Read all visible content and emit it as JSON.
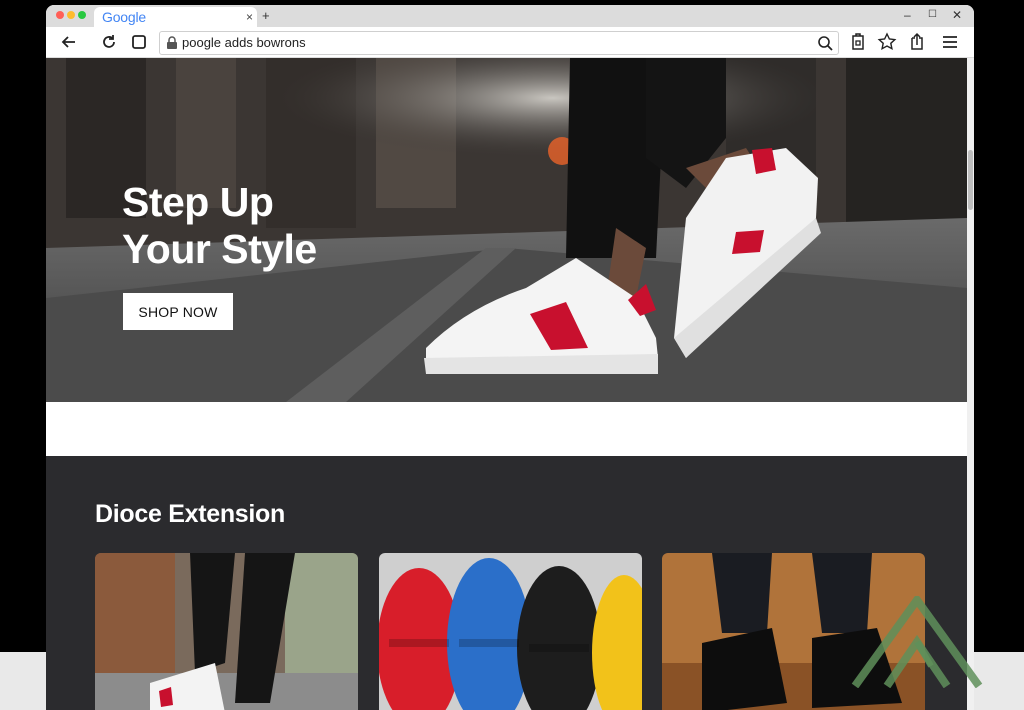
{
  "browser": {
    "tab_title": "Google",
    "tab_close": "×",
    "new_tab": "+",
    "minimize": "–",
    "maximize": "☐",
    "close": "✕",
    "url": "poogle adds bowrons"
  },
  "hero": {
    "title_line1": "Step Up",
    "title_line2": "Your Style",
    "cta_label": "SHOP NOW"
  },
  "section": {
    "title": "Dioce Extension"
  },
  "colors": {
    "accent_red": "#c8102e",
    "dark_section": "#2b2b2e"
  },
  "icons": [
    "back-icon",
    "reload-icon",
    "stop-icon",
    "lock-icon",
    "search-icon",
    "extension-icon",
    "star-icon",
    "share-icon",
    "menu-icon"
  ]
}
